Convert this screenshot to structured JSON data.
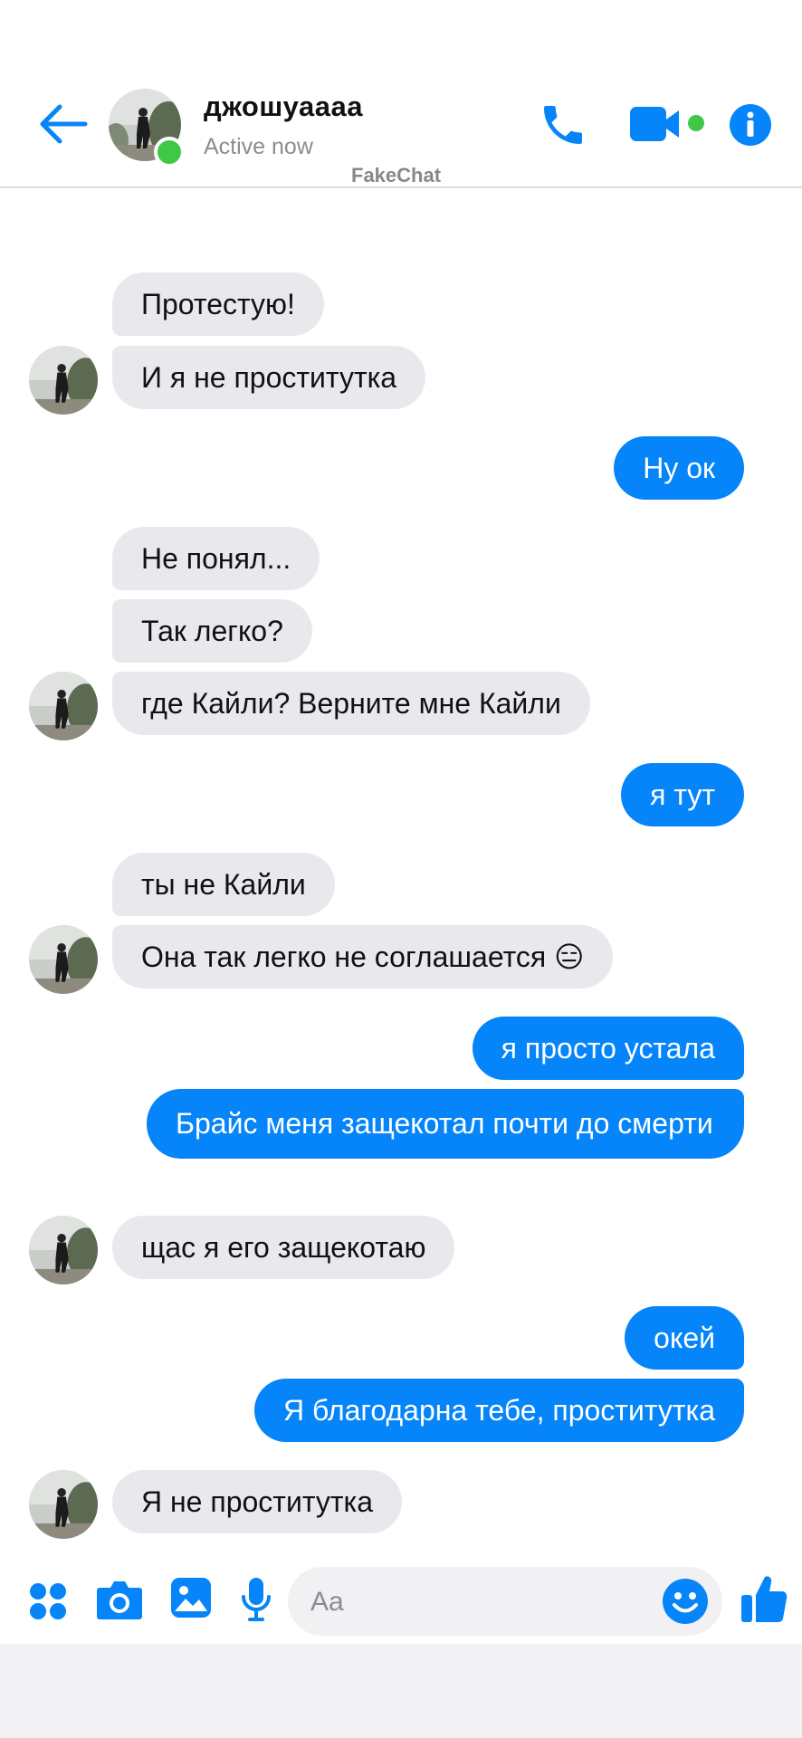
{
  "header": {
    "contact_name": "джошуаааа",
    "status": "Active now",
    "watermark": "FakeChat"
  },
  "colors": {
    "accent": "#0585f9",
    "incoming_bubble": "#e9e8ec",
    "online": "#3ec845"
  },
  "icons": [
    "back-arrow-icon",
    "phone-icon",
    "video-camera-icon",
    "info-icon",
    "apps-grid-icon",
    "camera-icon",
    "gallery-icon",
    "microphone-icon",
    "emoji-icon",
    "thumbs-up-icon"
  ],
  "messages": [
    {
      "dir": "in",
      "text": "Протестую!"
    },
    {
      "dir": "in",
      "text": "И я не проститутка"
    },
    {
      "dir": "out",
      "text": "Ну ок"
    },
    {
      "dir": "in",
      "text": "Не понял..."
    },
    {
      "dir": "in",
      "text": "Так легко?"
    },
    {
      "dir": "in",
      "text": "где Кайли? Верните мне Кайли"
    },
    {
      "dir": "out",
      "text": "я тут"
    },
    {
      "dir": "in",
      "text": "ты не Кайли"
    },
    {
      "dir": "in",
      "text": "Она так легко не соглашается 😑"
    },
    {
      "dir": "out",
      "text": "я просто устала"
    },
    {
      "dir": "out",
      "text": "Брайс меня защекотал почти до смерти"
    },
    {
      "dir": "in",
      "text": "щас я его защекотаю"
    },
    {
      "dir": "out",
      "text": "окей"
    },
    {
      "dir": "out",
      "text": "Я благодарна тебе, проститутка"
    },
    {
      "dir": "in",
      "text": "Я не проститутка"
    }
  ],
  "composer": {
    "placeholder": "Aa"
  }
}
